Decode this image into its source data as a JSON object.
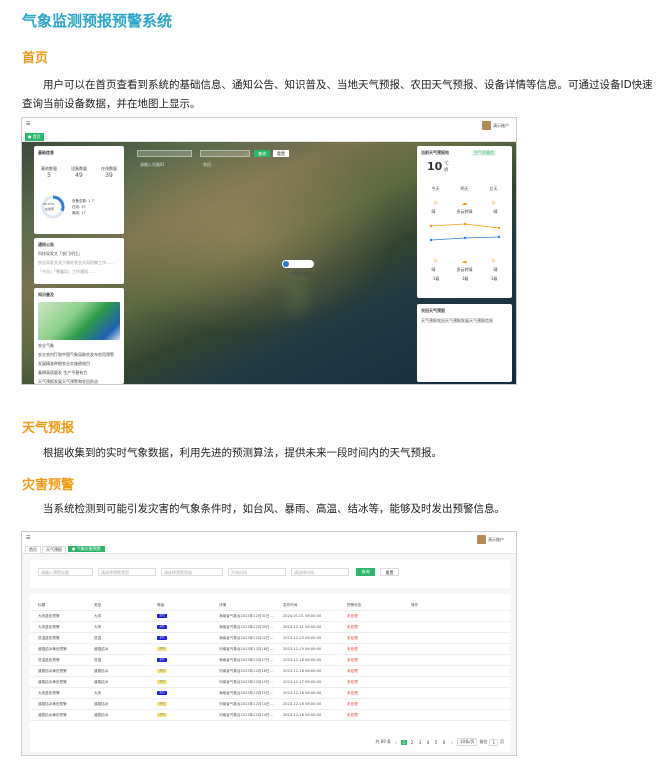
{
  "doc_title": "气象监测预报预警系统",
  "sections": [
    {
      "heading": "首页",
      "body": "用户可以在首页查看到系统的基础信息、通知公告、知识普及、当地天气预报、农田天气预报、设备详情等信息。可通过设备ID快速查询当前设备数据，并在地图上显示。"
    },
    {
      "heading": "天气预报",
      "body": "根据收集到的实时气象数据，利用先进的预测算法，提供未来一段时间内的天气预报。"
    },
    {
      "heading": "灾害预警",
      "body": "当系统检测到可能引发灾害的气象条件时，如台风、暴雨、高温、结冰等，能够及时发出预警信息。"
    }
  ],
  "shot1": {
    "user": "演示账户",
    "tab": "● 首页",
    "search_placeholder": "请输入设备ID",
    "select_value": "农田",
    "search_btn": "查询",
    "reset_btn": "重置",
    "basic_info": {
      "title": "基础信息",
      "labels": [
        "基地数量",
        "设备数量",
        "在线数量"
      ],
      "values": [
        "5",
        "49",
        "39"
      ]
    },
    "ring": {
      "label": "30.53%",
      "sublabel": "在线率",
      "legend": [
        "在线: 37",
        "离线: 17",
        "设备总数: 1 7"
      ],
      "online_fraction": 0.31
    },
    "notice": {
      "title": "通知公告",
      "items": [
        "科技局发文「农门评比」",
        "农业局发文关于做好农业大风防御工作……",
        "「台风」「寒露风」工作通知……"
      ]
    },
    "knowledge": {
      "title": "知识普及",
      "items": [
        "农业气象",
        "农业农村厅和中国气象局联合发布农用预警",
        "发展精准种植农业实施绩效目",
        "春耕高质量发 生产平稳有力",
        "天气预报发展天气预警和农田防治"
      ]
    },
    "marker_label": "中国(北京)",
    "forecast": {
      "title": "当前天气预报地",
      "badge": "空气质量良",
      "temp": "10",
      "unit": "°C",
      "desc": "阴",
      "days": [
        "今天",
        "明天",
        "后天"
      ],
      "day_icons": [
        "☼",
        "☁",
        "☼"
      ],
      "day_desc": [
        "晴",
        "多云转晴",
        "晴"
      ],
      "lows": [
        "-1级",
        "-1级",
        "-1级"
      ]
    },
    "farm": {
      "title": "农田天气预报",
      "text": "天气预报农田天气预报发展天气预报信息"
    }
  },
  "shot2": {
    "user": "演示账户",
    "tabs": [
      "首页",
      "天气预报",
      "● 气象灾害预警"
    ],
    "filters": [
      "请输入预警标题",
      "请选择预警类型",
      "请选择预警等级",
      "开始时间",
      "请选择时间"
    ],
    "search_btn": "查询",
    "reset_btn": "重置",
    "headers": [
      "标题",
      "类型",
      "等级",
      "详情",
      "发布时间",
      "预警状态",
      "操作"
    ],
    "rows": [
      [
        "大风蓝色预警",
        "大风",
        "蓝色",
        "海南省气象台2023年12月31日…",
        "2024-01-01 06:00:00",
        "未处理"
      ],
      [
        "大风蓝色预警",
        "大风",
        "蓝色",
        "海南省气象台2023年12月30日…",
        "2023-12-31 06:00:00",
        "未处理"
      ],
      [
        "低温蓝色预警",
        "低温",
        "蓝色",
        "海南省气象台2023年12月22日…",
        "2023-12-23 06:00:00",
        "未处理"
      ],
      [
        "道路结冰黄色预警",
        "道路结冰",
        "黄色",
        "河南省气象台2023年12月18日…",
        "2023-12-19 06:00:00",
        "未处理"
      ],
      [
        "低温蓝色预警",
        "低温",
        "蓝色",
        "海南省气象台2023年12月17日…",
        "2023-12-18 06:00:00",
        "未处理"
      ],
      [
        "道路结冰黄色预警",
        "道路结冰",
        "黄色",
        "河南省气象台2023年12月16日…",
        "2023-12-18 06:00:00",
        "未处理"
      ],
      [
        "道路结冰黄色预警",
        "道路结冰",
        "黄色",
        "河南省气象台2023年12月15日…",
        "2023-12-17 06:00:00",
        "未处理"
      ],
      [
        "大风蓝色预警",
        "大风",
        "蓝色",
        "海南省气象台2023年12月15日…",
        "2023-12-16 06:00:00",
        "未处理"
      ],
      [
        "道路结冰黄色预警",
        "道路结冰",
        "黄色",
        "河南省气象台2023年12月14日…",
        "2023-12-16 06:00:00",
        "未处理"
      ],
      [
        "道路结冰黄色预警",
        "道路结冰",
        "黄色",
        "河南省气象台2023年12月14日…",
        "2023-12-16 06:00:00",
        "未处理"
      ]
    ],
    "pagination": [
      "共 89 条",
      "‹",
      "1",
      "2",
      "3",
      "4",
      "5",
      "6",
      "›",
      "10条/页",
      "前往",
      "1",
      "页"
    ],
    "colors": {
      "blue": "#1a1ad8",
      "yellow": "#f1e27a",
      "green": "#2cb66a"
    }
  }
}
